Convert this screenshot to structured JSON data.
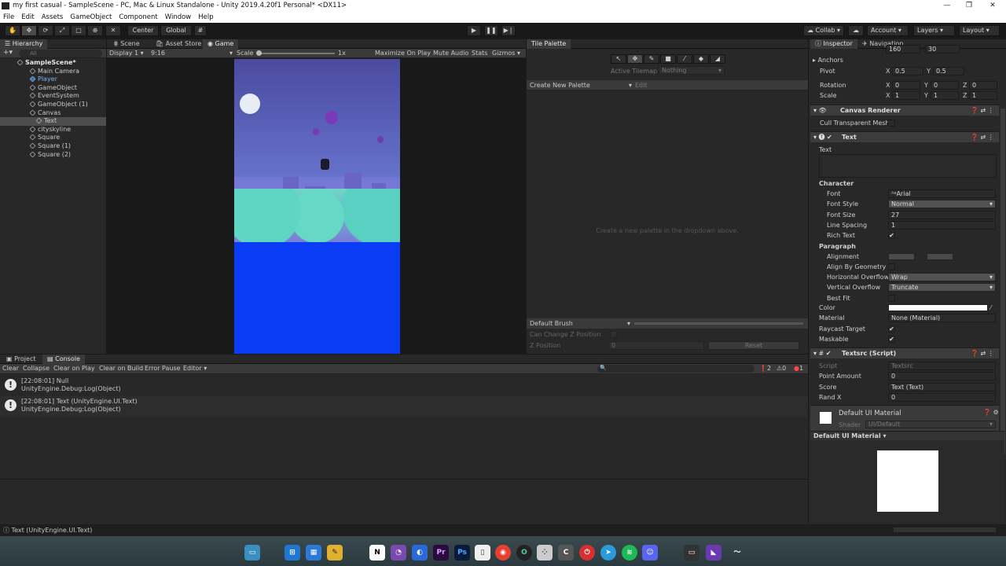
{
  "window": {
    "title": "my first casual - SampleScene - PC, Mac & Linux Standalone - Unity 2019.4.20f1 Personal* <DX11>"
  },
  "menu": [
    "File",
    "Edit",
    "Assets",
    "GameObject",
    "Component",
    "Window",
    "Help"
  ],
  "toolbar": {
    "center": "Center",
    "global": "Global",
    "collab": "Collab",
    "account": "Account",
    "layers": "Layers",
    "layout": "Layout"
  },
  "hierarchy": {
    "tab": "Hierarchy",
    "search": "All",
    "items": [
      {
        "label": "SampleScene*",
        "depth": 0,
        "type": "scene"
      },
      {
        "label": "Main Camera",
        "depth": 1,
        "type": "go"
      },
      {
        "label": "Player",
        "depth": 1,
        "type": "prefab"
      },
      {
        "label": "GameObject",
        "depth": 1,
        "type": "go"
      },
      {
        "label": "EventSystem",
        "depth": 1,
        "type": "go"
      },
      {
        "label": "GameObject (1)",
        "depth": 1,
        "type": "go"
      },
      {
        "label": "Canvas",
        "depth": 1,
        "type": "go"
      },
      {
        "label": "Text",
        "depth": 2,
        "type": "go",
        "selected": true
      },
      {
        "label": "cityskyline",
        "depth": 1,
        "type": "go"
      },
      {
        "label": "Square",
        "depth": 1,
        "type": "go"
      },
      {
        "label": "Square (1)",
        "depth": 1,
        "type": "go"
      },
      {
        "label": "Square (2)",
        "depth": 1,
        "type": "go"
      }
    ]
  },
  "game": {
    "tabs": [
      "Scene",
      "Asset Store",
      "Game"
    ],
    "display": "Display 1",
    "aspect": "9:16",
    "scale_label": "Scale",
    "scale_value": "1x",
    "opts": [
      "Maximize On Play",
      "Mute Audio",
      "Stats",
      "Gizmos"
    ]
  },
  "tile": {
    "tab": "Tile Palette",
    "active_tilemap": "Active Tilemap",
    "nothing": "Nothing",
    "create": "Create New Palette",
    "edit": "Edit",
    "empty": "Create a new palette in the dropdown above.",
    "brush": "Default Brush",
    "can_change": "Can Change Z Position",
    "zpos": "Z Position",
    "zval": "0",
    "reset": "Reset"
  },
  "inspector": {
    "tabs": [
      "Inspector",
      "Navigation"
    ],
    "top_vals": [
      "160",
      "30"
    ],
    "anchors": "Anchors",
    "pivot": "Pivot",
    "pivot_x": "0.5",
    "pivot_y": "0.5",
    "rotation": "Rotation",
    "rot": [
      "0",
      "0",
      "0"
    ],
    "scale": "Scale",
    "scl": [
      "1",
      "1",
      "1"
    ],
    "canvas_renderer": "Canvas Renderer",
    "cull": "Cull Transparent Mesh",
    "text_comp": "Text",
    "text_label": "Text",
    "character": "Character",
    "font": "Font",
    "font_val": "Arial",
    "font_style": "Font Style",
    "font_style_val": "Normal",
    "font_size": "Font Size",
    "font_size_val": "27",
    "line_spacing": "Line Spacing",
    "line_spacing_val": "1",
    "rich_text": "Rich Text",
    "paragraph": "Paragraph",
    "alignment": "Alignment",
    "align_geom": "Align By Geometry",
    "h_overflow": "Horizontal Overflow",
    "h_overflow_val": "Wrap",
    "v_overflow": "Vertical Overflow",
    "v_overflow_val": "Truncate",
    "best_fit": "Best Fit",
    "color": "Color",
    "material": "Material",
    "material_val": "None (Material)",
    "raycast": "Raycast Target",
    "maskable": "Maskable",
    "script_comp": "Textsrc (Script)",
    "script": "Script",
    "script_val": "Textsrc",
    "point_amount": "Point Amount",
    "point_amount_val": "0",
    "score": "Score",
    "score_val": "Text (Text)",
    "randx": "Rand X",
    "randx_val": "0",
    "mat_name": "Default UI Material",
    "shader": "Shader",
    "shader_val": "UI/Default",
    "preview_label": "Default UI Material"
  },
  "console": {
    "tabs": [
      "Project",
      "Console"
    ],
    "btns": [
      "Clear",
      "Collapse",
      "Clear on Play",
      "Clear on Build",
      "Error Pause",
      "Editor"
    ],
    "counts": [
      "2",
      "0",
      "1"
    ],
    "items": [
      {
        "line1": "[22:08:01] Null",
        "line2": "UnityEngine.Debug:Log(Object)"
      },
      {
        "line1": "[22:08:01] Text (UnityEngine.UI.Text)",
        "line2": "UnityEngine.Debug:Log(Object)"
      }
    ]
  },
  "status": "Text (UnityEngine.UI.Text)",
  "colors": {
    "accent": "#3a72b0",
    "sky_top": "#4b4aa0",
    "sky_bottom": "#7a8ee0",
    "ground": "#0a3bf5"
  }
}
